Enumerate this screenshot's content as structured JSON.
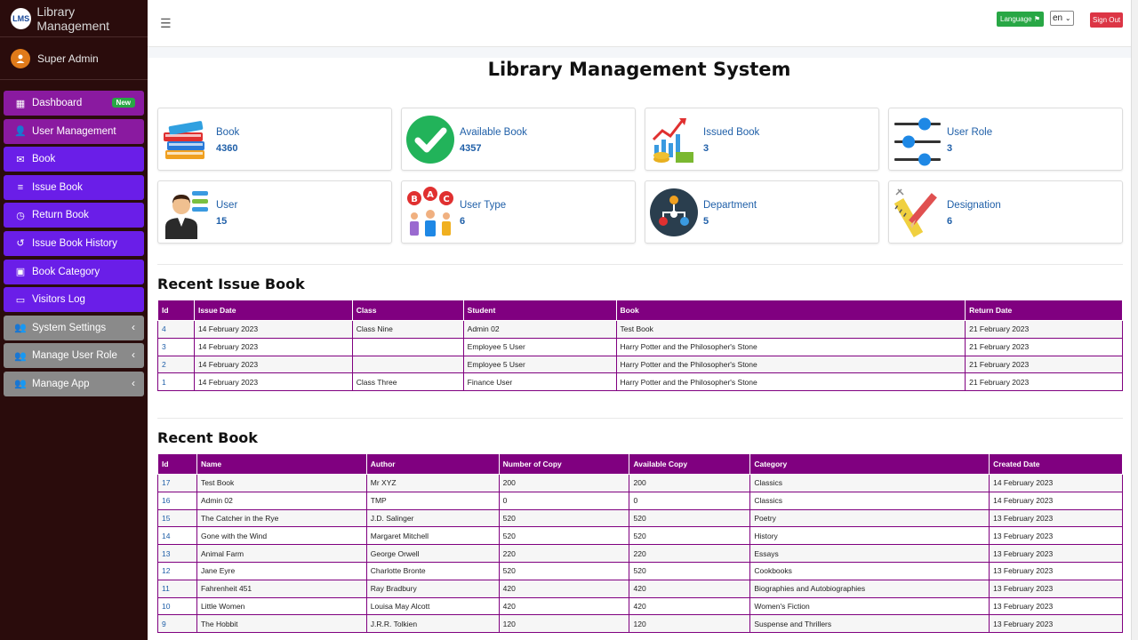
{
  "app": {
    "brand": "Library Management",
    "logo_text": "LMS"
  },
  "user": {
    "name": "Super Admin"
  },
  "sidebar": {
    "items": [
      {
        "label": "Dashboard",
        "icon": "grid-icon",
        "badge": "New"
      },
      {
        "label": "User Management",
        "icon": "users-gear-icon"
      },
      {
        "label": "Book",
        "icon": "envelope-icon"
      },
      {
        "label": "Issue Book",
        "icon": "database-icon"
      },
      {
        "label": "Return Book",
        "icon": "clock-icon"
      },
      {
        "label": "Issue Book History",
        "icon": "history-icon"
      },
      {
        "label": "Book Category",
        "icon": "briefcase-icon"
      },
      {
        "label": "Visitors Log",
        "icon": "monitor-icon"
      },
      {
        "label": "System Settings",
        "icon": "users-gear-icon"
      },
      {
        "label": "Manage User Role",
        "icon": "users-gear-icon"
      },
      {
        "label": "Manage App",
        "icon": "users-gear-icon"
      }
    ]
  },
  "topbar": {
    "language_label": "Language",
    "language_value": "en",
    "signout_label": "Sign Out"
  },
  "page": {
    "title": "Library Management System"
  },
  "cards": [
    {
      "label": "Book",
      "value": "4360",
      "icon": "books-icon"
    },
    {
      "label": "Available Book",
      "value": "4357",
      "icon": "checkmark-icon"
    },
    {
      "label": "Issued Book",
      "value": "3",
      "icon": "growth-chart-icon"
    },
    {
      "label": "User Role",
      "value": "3",
      "icon": "sliders-icon"
    },
    {
      "label": "User",
      "value": "15",
      "icon": "businessman-icon"
    },
    {
      "label": "User Type",
      "value": "6",
      "icon": "abc-people-icon"
    },
    {
      "label": "Department",
      "value": "5",
      "icon": "hierarchy-icon"
    },
    {
      "label": "Designation",
      "value": "6",
      "icon": "ruler-pencil-icon"
    }
  ],
  "recent_issue": {
    "title": "Recent Issue Book",
    "columns": [
      "Id",
      "Issue Date",
      "Class",
      "Student",
      "Book",
      "Return Date"
    ],
    "rows": [
      [
        "4",
        "14 February 2023",
        "Class Nine",
        "Admin 02",
        "Test Book",
        "21 February 2023"
      ],
      [
        "3",
        "14 February 2023",
        "",
        "Employee 5 User",
        "Harry Potter and the Philosopher's Stone",
        "21 February 2023"
      ],
      [
        "2",
        "14 February 2023",
        "",
        "Employee 5 User",
        "Harry Potter and the Philosopher's Stone",
        "21 February 2023"
      ],
      [
        "1",
        "14 February 2023",
        "Class Three",
        "Finance User",
        "Harry Potter and the Philosopher's Stone",
        "21 February 2023"
      ]
    ]
  },
  "recent_book": {
    "title": "Recent Book",
    "columns": [
      "Id",
      "Name",
      "Author",
      "Number of Copy",
      "Available Copy",
      "Category",
      "Created Date"
    ],
    "rows": [
      [
        "17",
        "Test Book",
        "Mr XYZ",
        "200",
        "200",
        "Classics",
        "14 February 2023"
      ],
      [
        "16",
        "Admin 02",
        "TMP",
        "0",
        "0",
        "Classics",
        "14 February 2023"
      ],
      [
        "15",
        "The Catcher in the Rye",
        "J.D. Salinger",
        "520",
        "520",
        "Poetry",
        "13 February 2023"
      ],
      [
        "14",
        "Gone with the Wind",
        "Margaret Mitchell",
        "520",
        "520",
        "History",
        "13 February 2023"
      ],
      [
        "13",
        "Animal Farm",
        "George Orwell",
        "220",
        "220",
        "Essays",
        "13 February 2023"
      ],
      [
        "12",
        "Jane Eyre",
        "Charlotte Bronte",
        "520",
        "520",
        "Cookbooks",
        "13 February 2023"
      ],
      [
        "11",
        "Fahrenheit 451",
        "Ray Bradbury",
        "420",
        "420",
        "Biographies and Autobiographies",
        "13 February 2023"
      ],
      [
        "10",
        "Little Women",
        "Louisa May Alcott",
        "420",
        "420",
        "Women's Fiction",
        "13 February 2023"
      ],
      [
        "9",
        "The Hobbit",
        "J.R.R. Tolkien",
        "120",
        "120",
        "Suspense and Thrillers",
        "13 February 2023"
      ]
    ]
  }
}
